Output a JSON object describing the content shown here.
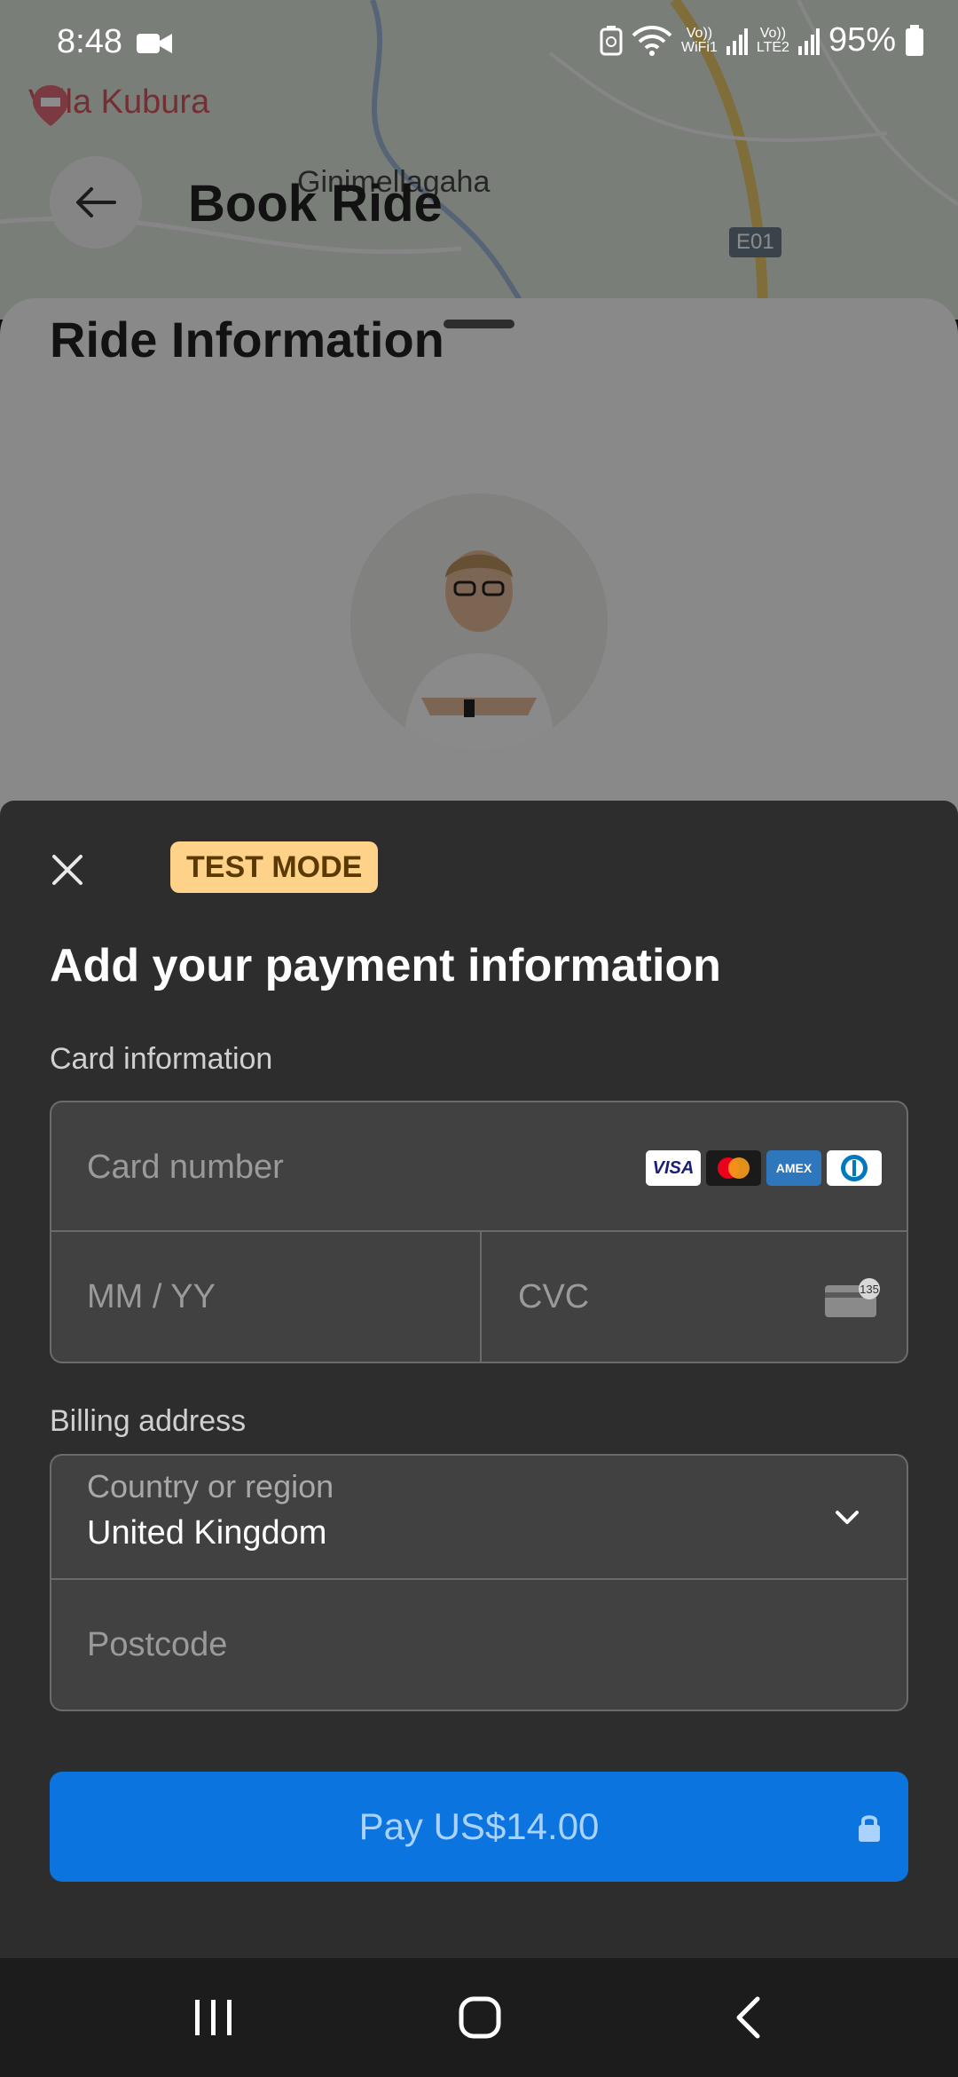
{
  "status_bar": {
    "time": "8:48",
    "wifi_label_top": "Vo))",
    "wifi_label_bottom": "WiFi1",
    "lte_label_top": "Vo))",
    "lte_label_bottom": "LTE2",
    "battery": "95%"
  },
  "background": {
    "map_poi": "Villa Kubura",
    "map_place": "Ginimellagaha",
    "road_badge": "E01",
    "page_title": "Book Ride",
    "section_title": "Ride Information"
  },
  "payment": {
    "badge": "TEST MODE",
    "title": "Add your payment information",
    "card_section_label": "Card information",
    "card_number_placeholder": "Card number",
    "expiry_placeholder": "MM / YY",
    "cvc_placeholder": "CVC",
    "cvc_icon_text": "135",
    "brands": [
      "VISA",
      "mastercard",
      "AMEX",
      "diners"
    ],
    "billing_section_label": "Billing address",
    "country_label": "Country or region",
    "country_value": "United Kingdom",
    "postcode_placeholder": "Postcode",
    "pay_button_label": "Pay US$14.00"
  },
  "colors": {
    "sheet": "#2d2d2d",
    "field": "#414141",
    "pay_button": "#0b74de",
    "badge": "#ffd28a"
  }
}
